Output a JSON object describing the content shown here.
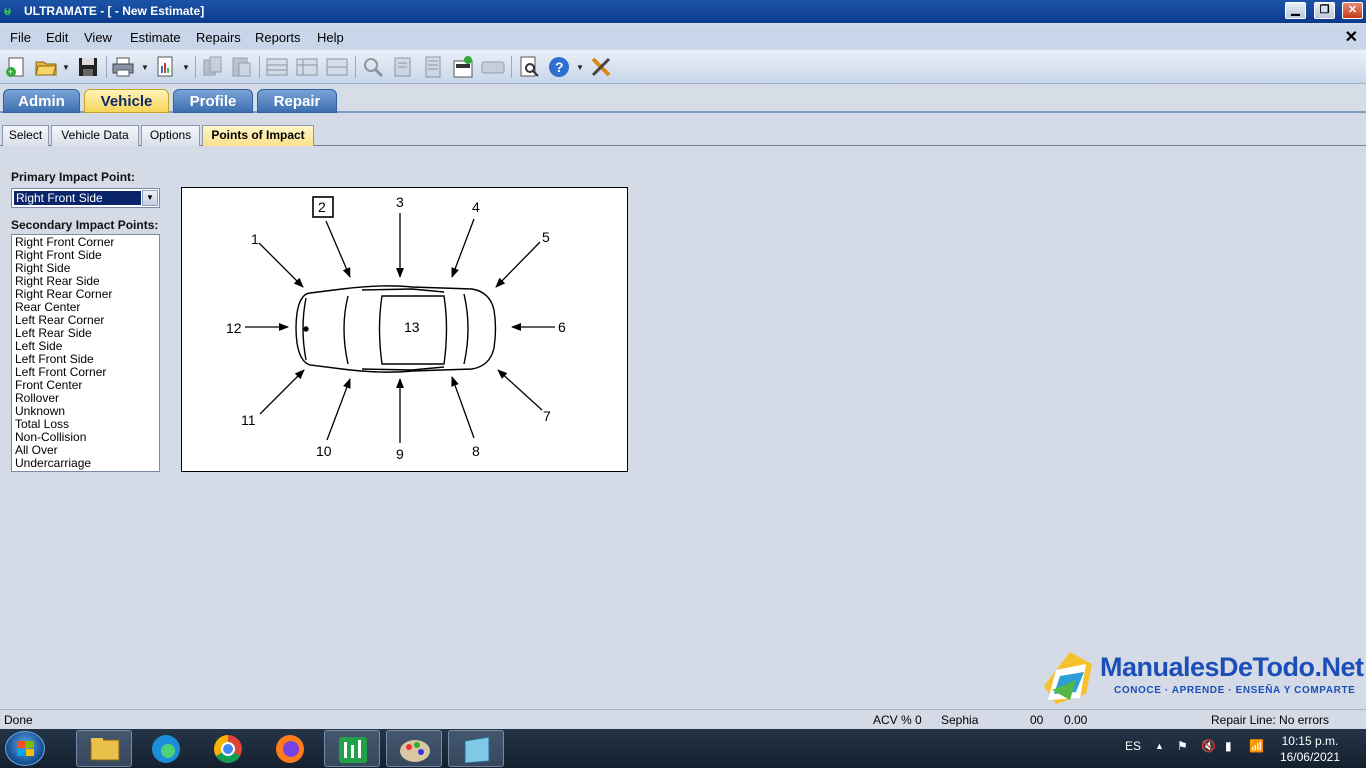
{
  "window": {
    "title": "ULTRAMATE - [ - New Estimate]",
    "app_icon": "ultramate-logo-icon"
  },
  "menu": [
    "File",
    "Edit",
    "View",
    "Estimate",
    "Repairs",
    "Reports",
    "Help"
  ],
  "nav_tabs": [
    "Admin",
    "Vehicle",
    "Profile",
    "Repair"
  ],
  "nav_active": "Vehicle",
  "sub_tabs": [
    "Select",
    "Vehicle Data",
    "Options",
    "Points of Impact"
  ],
  "sub_active": "Points of Impact",
  "impact": {
    "primary_label": "Primary Impact Point:",
    "primary_value": "Right Front Side",
    "secondary_label": "Secondary Impact Points:",
    "secondary_items": [
      "Right Front Corner",
      "Right Front Side",
      "Right Side",
      "Right Rear Side",
      "Right Rear Corner",
      "Rear Center",
      "Left Rear Corner",
      "Left Rear Side",
      "Left Side",
      "Left Front Side",
      "Left Front Corner",
      "Front Center",
      "Rollover",
      "Unknown",
      "Total Loss",
      "Non-Collision",
      "All Over",
      "Undercarriage"
    ]
  },
  "diagram": {
    "numbers": [
      "1",
      "2",
      "3",
      "4",
      "5",
      "6",
      "7",
      "8",
      "9",
      "10",
      "11",
      "12",
      "13"
    ],
    "selected": "2"
  },
  "status": {
    "left": "Done",
    "acv": "ACV % 0",
    "user": "Sephia",
    "code": "00",
    "amount": "0.00",
    "repair_line": "Repair Line: No errors"
  },
  "watermark": {
    "title": "ManualesDeTodo.Net",
    "subtitle": "CONOCE · APRENDE · ENSEÑA Y COMPARTE"
  },
  "taskbar": {
    "lang": "ES",
    "time": "10:15 p.m.",
    "date": "16/06/2021"
  },
  "colors": {
    "title_bar": "#0a3a8c",
    "active_tab": "#f7d55a",
    "selection": "#0a246a"
  }
}
